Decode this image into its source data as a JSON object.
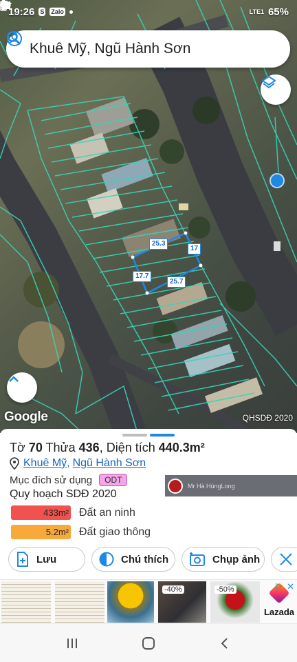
{
  "status_bar": {
    "time": "19:26",
    "battery": "65%",
    "network": "LTE1",
    "left_icons": [
      "s-icon",
      "zalo-icon",
      "cloud-icon",
      "dot-icon"
    ],
    "right_icons": [
      "location-icon",
      "wifi-icon",
      "signal-icon",
      "battery-icon"
    ]
  },
  "search": {
    "title": "Khuê Mỹ, Ngũ Hành Sơn",
    "left_icon": "account-icon",
    "right_icon": "search-icon"
  },
  "map": {
    "parcel_dimensions": [
      "25.3",
      "17",
      "17.7",
      "25.7"
    ],
    "google_logo": "Google",
    "caption": "QHSDĐ 2020",
    "location_dot_color": "#1e88e5",
    "parcel_outline_color": "#1e88e5",
    "cadastral_line_color": "#39d3b8"
  },
  "sheet": {
    "title_prefix": "Tờ",
    "sheet_no": "70",
    "plot_label": "Thửa",
    "plot_no": "436",
    "area_label": ", Diện tích",
    "area_value": "440.3m²",
    "address_ward": "Khuê Mỹ",
    "address_sep": ",",
    "address_district": "Ngũ Hành Sơn",
    "usage_label": "Mục đích sử dụng",
    "usage_code": "ODT",
    "plan_label": "Quy hoạch SDĐ 2020",
    "land_uses": [
      {
        "area": "433m²",
        "label": "Đất an ninh",
        "color": "#f0524f"
      },
      {
        "area": "5.2m²",
        "label": "Đất giao thông",
        "color": "#f7a93b"
      }
    ],
    "actions": {
      "save": "Lưu",
      "legend": "Chú thích",
      "photo": "Chụp ảnh"
    }
  },
  "notification": {
    "text": "Mr Hà HùngLong"
  },
  "ad": {
    "discounts": [
      "-40%",
      "-50%"
    ],
    "brand": "Lazada"
  }
}
